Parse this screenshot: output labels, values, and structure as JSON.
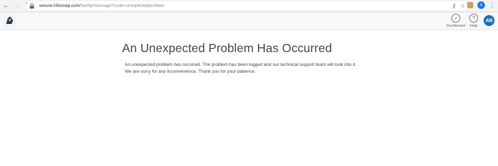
{
  "browser": {
    "url_host": "secure.infosnap.com",
    "url_path": "/family/message?code=unexpectedproblem",
    "profile_initial": "A"
  },
  "header": {
    "nav": [
      {
        "label": "Dashboard",
        "icon": "dashboard-gauge-icon"
      },
      {
        "label": "Help",
        "icon": "help-question-icon"
      }
    ],
    "avatar_initials": "AB"
  },
  "main": {
    "title": "An Unexpected Problem Has Occurred",
    "message_lines": [
      "An unexpected problem has occurred. The problem has been logged and our technical support team will look into it.",
      "We are sorry for any inconvenience. Thank you for your patience."
    ]
  },
  "colors": {
    "avatar_bg": "#1f6fb3",
    "profile_dot": "#1a73e8",
    "browser_bar": "#f1f3f4"
  }
}
